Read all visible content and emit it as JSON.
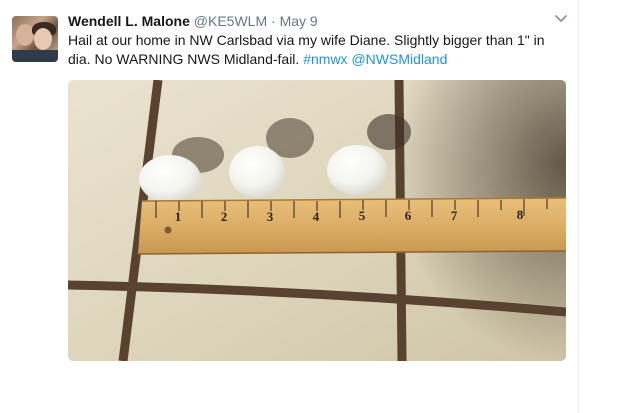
{
  "tweet": {
    "author_name": "Wendell L. Malone",
    "author_handle": "@KE5WLM",
    "separator": "·",
    "timestamp": "May 9",
    "text_plain": "Hail at our home in NW Carlsbad via my wife Diane. Slightly bigger than 1\" in dia. No WARNING NWS Midland-fail. ",
    "hashtag": "#nmwx",
    "mention": "@NWSMidland",
    "space": " "
  },
  "icons": {
    "menu": "chevron-down-icon"
  },
  "photo": {
    "ruler_numbers": [
      "1",
      "2",
      "3",
      "4",
      "5",
      "6",
      "7",
      "8"
    ]
  },
  "colors": {
    "link": "#1b95e0",
    "name": "#14171a",
    "meta": "#657786"
  }
}
